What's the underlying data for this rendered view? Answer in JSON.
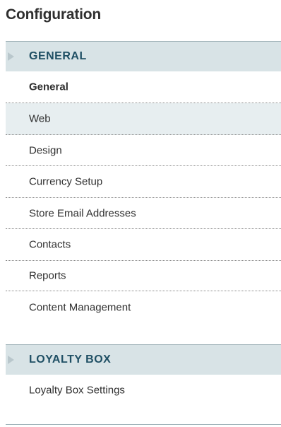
{
  "page": {
    "title": "Configuration"
  },
  "sections": [
    {
      "label": "GENERAL",
      "items": [
        {
          "label": "General"
        },
        {
          "label": "Web"
        },
        {
          "label": "Design"
        },
        {
          "label": "Currency Setup"
        },
        {
          "label": "Store Email Addresses"
        },
        {
          "label": "Contacts"
        },
        {
          "label": "Reports"
        },
        {
          "label": "Content Management"
        }
      ]
    },
    {
      "label": "LOYALTY BOX",
      "items": [
        {
          "label": "Loyalty Box Settings"
        }
      ]
    }
  ],
  "colors": {
    "section_bg": "#d8e3e6",
    "section_text": "#1f4f64",
    "highlight_row": "#e7eef0"
  }
}
